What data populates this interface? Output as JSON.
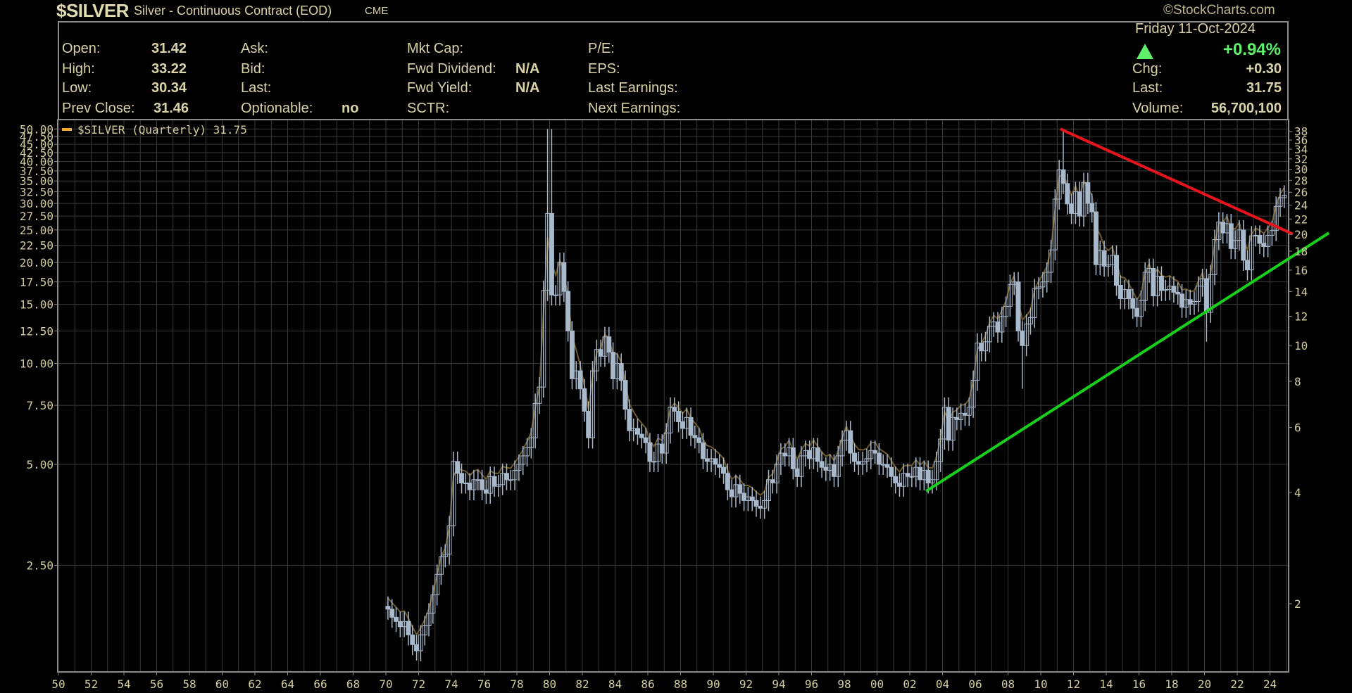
{
  "header": {
    "symbol": "$SILVER",
    "description": "Silver - Continuous Contract (EOD)",
    "exchange": "CME",
    "copyright": "©StockCharts.com",
    "date": "Friday  11-Oct-2024",
    "pct_change": "+0.94%",
    "direction_icon": "up-triangle-icon",
    "fields": [
      {
        "label": "Open:",
        "value": "31.42"
      },
      {
        "label": "High:",
        "value": "33.22"
      },
      {
        "label": "Low:",
        "value": "30.34"
      },
      {
        "label": "Prev Close:",
        "value": "31.46"
      },
      {
        "label": "Ask:",
        "value": ""
      },
      {
        "label": "Bid:",
        "value": ""
      },
      {
        "label": "Last:",
        "value": ""
      },
      {
        "label": "Optionable:",
        "value": "no"
      },
      {
        "label": "Mkt Cap:",
        "value": ""
      },
      {
        "label": "Fwd Dividend:",
        "value": "N/A"
      },
      {
        "label": "Fwd Yield:",
        "value": "N/A"
      },
      {
        "label": "SCTR:",
        "value": ""
      },
      {
        "label": "P/E:",
        "value": ""
      },
      {
        "label": "EPS:",
        "value": ""
      },
      {
        "label": "Last Earnings:",
        "value": ""
      },
      {
        "label": "Next Earnings:",
        "value": ""
      }
    ],
    "right_fields": [
      {
        "label": "Chg:",
        "value": "+0.30"
      },
      {
        "label": "Last:",
        "value": "31.75"
      },
      {
        "label": "Volume:",
        "value": "56,700,100"
      }
    ]
  },
  "colors": {
    "bars": "#a9b9cc",
    "overlay": "#6e5a2c",
    "legend": "#f0a830",
    "resistance": "#e8141c",
    "support": "#18d01c",
    "grid": "#3a3a3a",
    "up": "#5ef06a"
  },
  "chart_data": {
    "type": "ohlc",
    "title": "$SILVER (Quarterly) 31.75",
    "legend": {
      "label": "$SILVER (Quarterly) 31.75",
      "placement": "top-left"
    },
    "scale": "log",
    "xlim": [
      1950,
      2025.15
    ],
    "ylim_left": [
      1.45,
      52
    ],
    "x_tick_labels": [
      "50",
      "52",
      "54",
      "56",
      "58",
      "60",
      "62",
      "64",
      "66",
      "68",
      "70",
      "72",
      "74",
      "76",
      "78",
      "80",
      "82",
      "84",
      "86",
      "88",
      "90",
      "92",
      "94",
      "96",
      "98",
      "00",
      "02",
      "04",
      "06",
      "08",
      "10",
      "12",
      "14",
      "16",
      "18",
      "20",
      "22",
      "24"
    ],
    "left_ticks": [
      "50.00",
      "47.50",
      "45.00",
      "42.50",
      "40.00",
      "37.50",
      "35.00",
      "32.50",
      "30.00",
      "27.50",
      "25.00",
      "22.50",
      "20.00",
      "17.50",
      "15.00",
      "12.50",
      "10.00",
      "7.50",
      "5.00",
      "2.50"
    ],
    "right_ticks": [
      "38",
      "36",
      "34",
      "32",
      "30",
      "28",
      "26",
      "24",
      "22",
      "20",
      "18",
      "16",
      "14",
      "12",
      "10",
      "8",
      "6",
      "4",
      "2"
    ],
    "start_year": 1970,
    "quarterly_close": [
      1.85,
      1.75,
      1.7,
      1.64,
      1.7,
      1.55,
      1.45,
      1.39,
      1.55,
      1.65,
      1.8,
      2.04,
      2.35,
      2.65,
      2.7,
      3.28,
      5.1,
      4.7,
      4.4,
      4.4,
      4.2,
      4.5,
      4.5,
      4.2,
      4.1,
      4.6,
      4.3,
      4.35,
      4.7,
      4.5,
      4.5,
      4.8,
      5.0,
      5.3,
      5.6,
      6.0,
      7.6,
      8.5,
      16.5,
      28.0,
      16.0,
      16.0,
      20.0,
      16.4,
      12.5,
      9.0,
      9.5,
      8.4,
      7.2,
      6.0,
      9.5,
      11.0,
      10.5,
      12.0,
      10.8,
      9.0,
      10.0,
      8.9,
      7.3,
      6.3,
      6.4,
      6.15,
      6.0,
      5.8,
      5.1,
      5.1,
      5.75,
      5.4,
      6.2,
      7.4,
      7.2,
      6.7,
      6.4,
      6.9,
      6.1,
      6.0,
      5.8,
      5.2,
      5.1,
      5.2,
      5.0,
      4.9,
      4.7,
      4.2,
      4.0,
      4.35,
      4.1,
      3.9,
      4.0,
      3.9,
      3.75,
      3.7,
      3.9,
      4.5,
      4.4,
      5.0,
      5.4,
      5.3,
      5.6,
      4.85,
      4.6,
      5.3,
      5.5,
      5.2,
      5.6,
      5.1,
      4.9,
      4.8,
      5.0,
      4.6,
      5.3,
      5.9,
      6.3,
      5.4,
      5.1,
      5.0,
      5.1,
      5.2,
      5.5,
      5.4,
      5.0,
      5.0,
      4.9,
      4.6,
      4.4,
      4.3,
      4.7,
      4.6,
      4.6,
      4.9,
      4.5,
      4.8,
      4.4,
      4.5,
      5.1,
      5.95,
      7.4,
      5.9,
      6.9,
      6.8,
      7.1,
      7.0,
      7.4,
      8.9,
      11.5,
      10.9,
      11.6,
      12.9,
      13.3,
      12.4,
      13.8,
      14.8,
      17.2,
      17.5,
      12.5,
      11.3,
      13.1,
      13.7,
      16.7,
      16.9,
      17.5,
      18.7,
      21.8,
      30.9,
      37.8,
      34.4,
      29.9,
      28.0,
      32.5,
      27.5,
      34.6,
      30.0,
      28.3,
      19.7,
      21.7,
      19.5,
      19.7,
      21.0,
      17.1,
      15.6,
      16.6,
      15.6,
      14.6,
      13.8,
      15.4,
      18.7,
      19.2,
      15.9,
      18.2,
      16.5,
      16.6,
      17.0,
      16.3,
      16.1,
      14.7,
      15.5,
      15.0,
      15.3,
      17.0,
      17.9,
      14.2,
      18.4,
      23.4,
      26.4,
      24.5,
      26.1,
      22.0,
      23.3,
      25.0,
      20.3,
      19.0,
      24.0,
      24.1,
      22.8,
      22.3,
      24.1,
      24.9,
      29.4,
      31.2,
      31.75
    ],
    "extremes": [
      {
        "year": 1971.9,
        "low": 1.3
      },
      {
        "year": 1980.0,
        "high": 50.0
      },
      {
        "year": 2011.3,
        "high": 49.8
      },
      {
        "year": 2020.1,
        "low": 11.6
      },
      {
        "year": 2008.9,
        "low": 8.4
      }
    ],
    "trendlines": [
      {
        "name": "resistance",
        "from": [
          2011.2,
          50.0
        ],
        "to": [
          2025.4,
          24.3
        ]
      },
      {
        "name": "support",
        "from": [
          2003.0,
          4.16
        ],
        "to": [
          2027.6,
          24.5
        ]
      }
    ]
  }
}
